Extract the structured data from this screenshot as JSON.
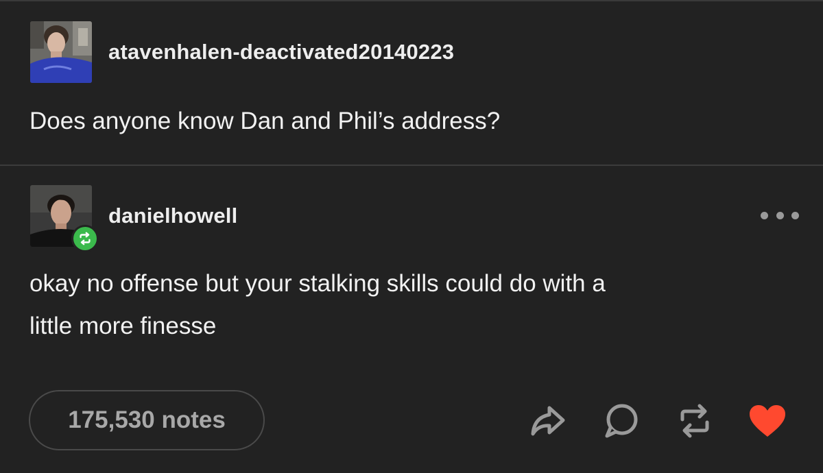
{
  "original_post": {
    "username": "atavenhalen-deactivated20140223",
    "text": "Does anyone know Dan and Phil’s address?"
  },
  "reblog_post": {
    "username": "danielhowell",
    "text_line1": "okay no offense but your stalking skills could do with a",
    "text_line2": "little more finesse"
  },
  "footer": {
    "notes_label": "175,530 notes"
  },
  "icons": {
    "share": "share-icon",
    "reply": "reply-icon",
    "reblog": "reblog-icon",
    "like": "heart-icon",
    "more": "more-options-icon"
  },
  "colors": {
    "background": "#222222",
    "reblog_green": "#3bba4c",
    "like_red": "#ff492f",
    "icon_gray": "#9a9a9a"
  }
}
